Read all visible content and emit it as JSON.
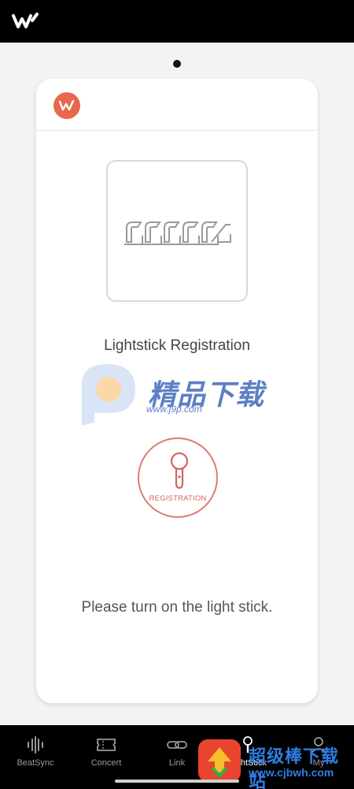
{
  "header": {
    "logo_icon": "weverse-w-logo-icon"
  },
  "pager": {
    "active_index": 1,
    "count": 1
  },
  "card": {
    "brand_icon": "brand-crown-icon",
    "lightstick_icon": "lightstick-row-icon",
    "title": "Lightstick Registration",
    "register_button": {
      "icon": "lightstick-icon",
      "label": "REGISTRATION"
    },
    "instruction": "Please turn on the light stick."
  },
  "watermark": {
    "text": "精品下载",
    "url": "www.j9p.com"
  },
  "overlay_watermark": {
    "text": "超级棒下载站",
    "url": "www.cjbwh.com"
  },
  "bottom_nav": {
    "items": [
      {
        "label": "BeatSync",
        "icon": "waveform-icon"
      },
      {
        "label": "Concert",
        "icon": "ticket-icon"
      },
      {
        "label": "Link",
        "icon": "link-icon"
      },
      {
        "label": "LightStick",
        "icon": "lightstick-icon"
      },
      {
        "label": "My",
        "icon": "person-icon"
      }
    ],
    "active": "LightStick"
  },
  "colors": {
    "accent": "#e8684e",
    "registration": "#de7a73",
    "bar": "#000000",
    "background": "#f3f3f3"
  }
}
